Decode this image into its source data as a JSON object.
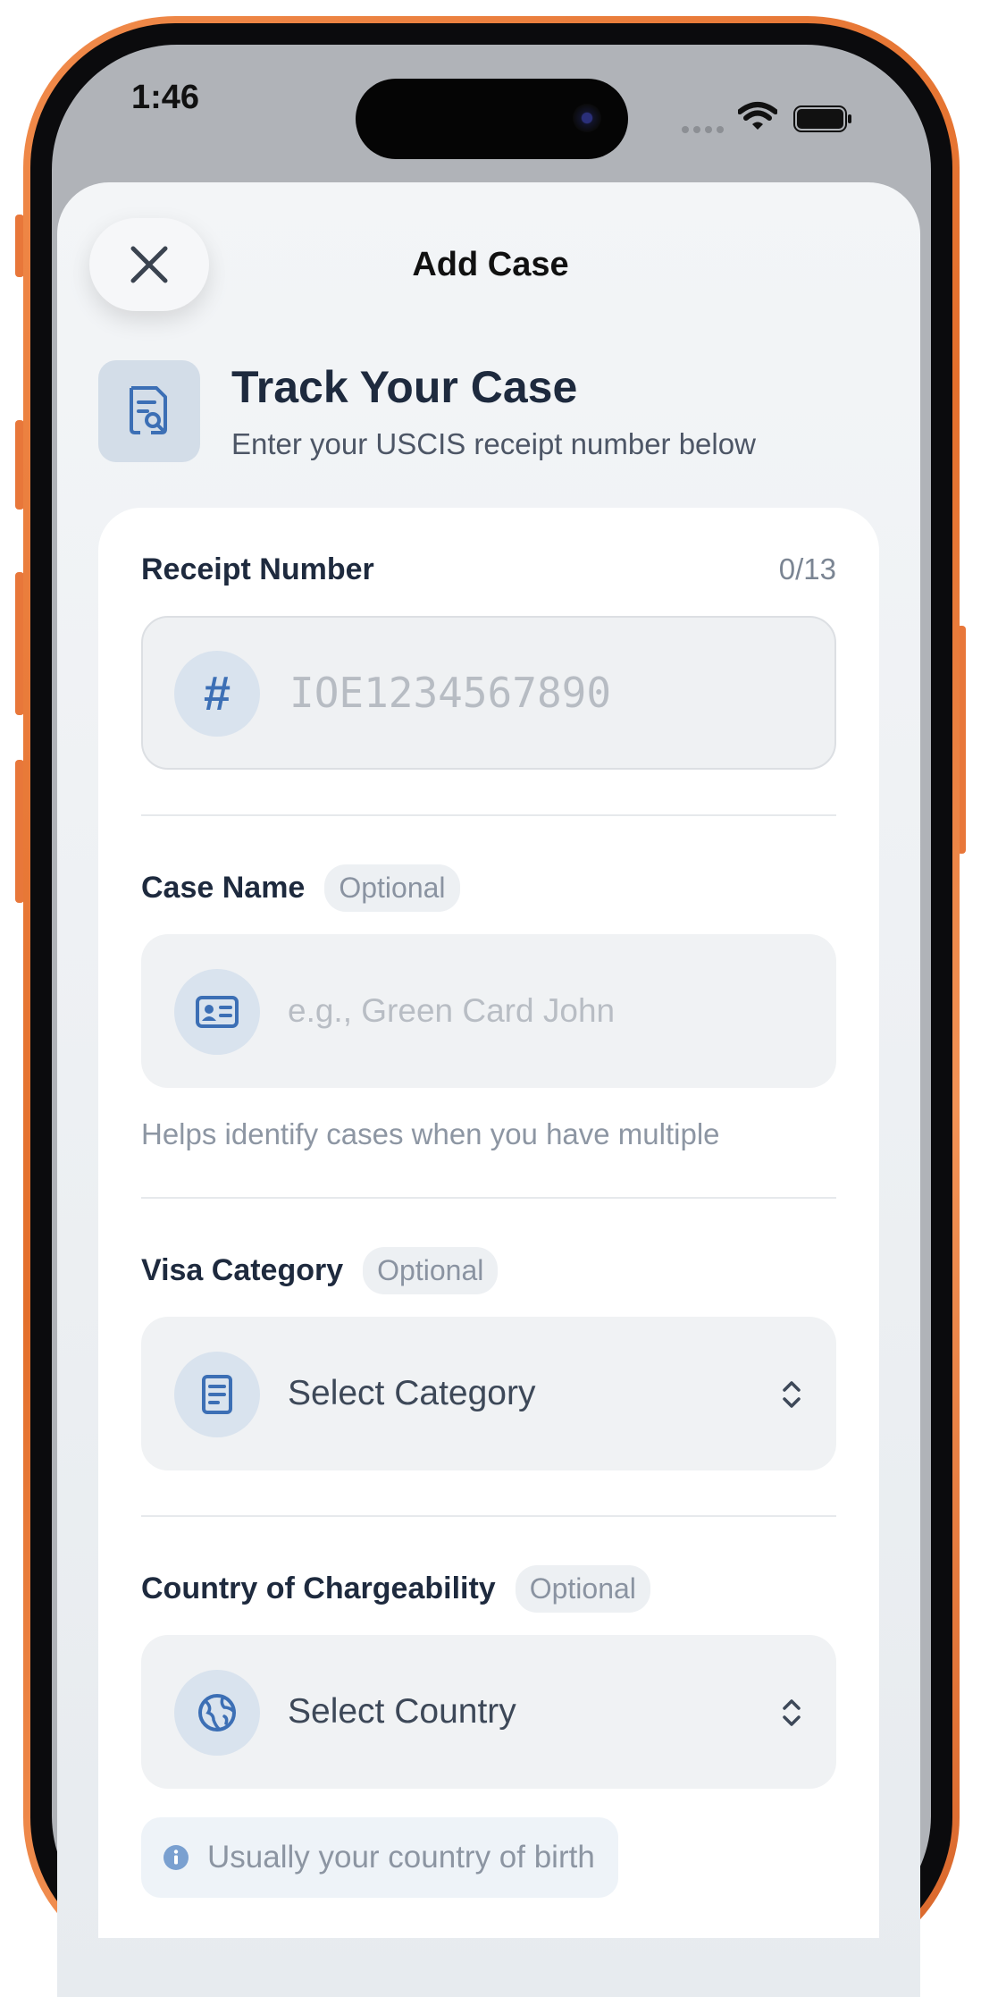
{
  "status_bar": {
    "time": "1:46"
  },
  "sheet": {
    "title": "Add Case",
    "close_icon": "close-icon"
  },
  "hero": {
    "title": "Track Your Case",
    "subtitle": "Enter your USCIS receipt number below",
    "icon": "document-search-icon"
  },
  "form": {
    "receipt": {
      "label": "Receipt Number",
      "counter": "0/13",
      "placeholder": "IOE1234567890",
      "icon": "hash-icon",
      "hash_glyph": "#"
    },
    "case_name": {
      "label": "Case Name",
      "badge": "Optional",
      "placeholder": "e.g., Green Card John",
      "helper": "Helps identify cases when you have multiple",
      "icon": "id-card-icon"
    },
    "visa_category": {
      "label": "Visa Category",
      "badge": "Optional",
      "value": "Select Category",
      "icon": "document-icon"
    },
    "country": {
      "label": "Country of Chargeability",
      "badge": "Optional",
      "value": "Select Country",
      "icon": "globe-icon",
      "info": "Usually your country of birth"
    }
  },
  "colors": {
    "accent": "#3c6fb5",
    "frame": "#e8773a",
    "title_text": "#1e2a3e"
  }
}
